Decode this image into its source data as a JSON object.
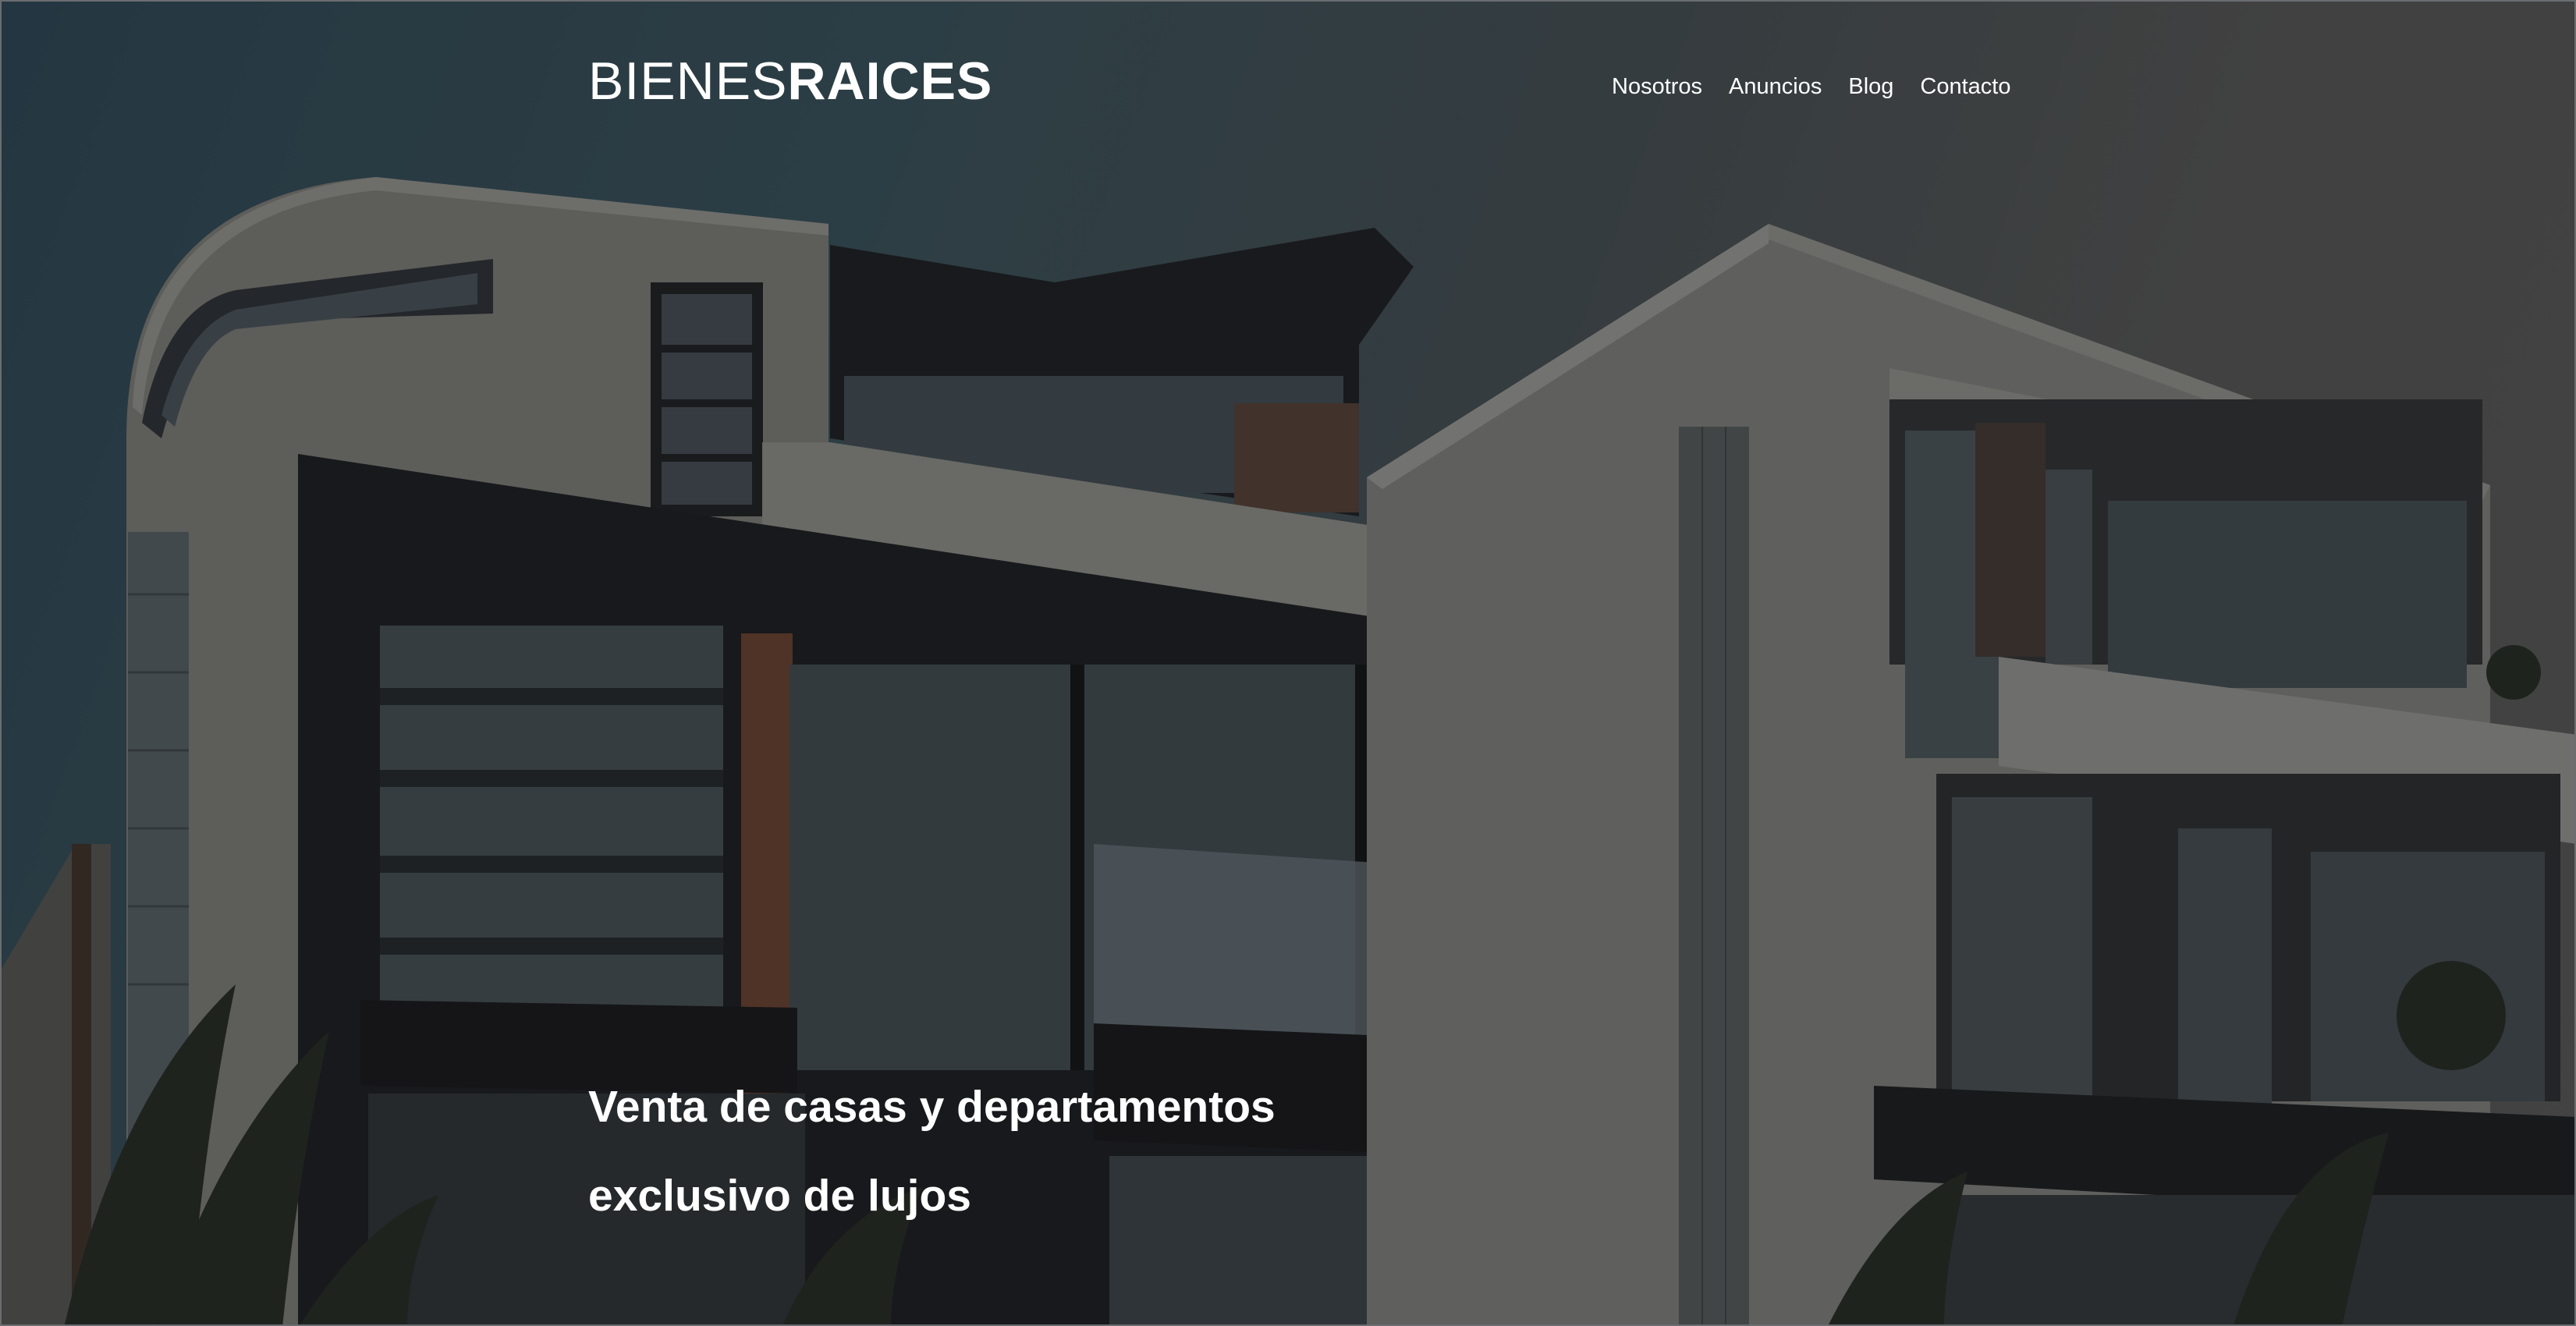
{
  "header": {
    "logo_light": "BIENES",
    "logo_bold": "RAICES"
  },
  "nav": {
    "items": [
      {
        "label": "Nosotros"
      },
      {
        "label": "Anuncios"
      },
      {
        "label": "Blog"
      },
      {
        "label": "Contacto"
      }
    ]
  },
  "hero": {
    "heading_line1": "Venta de casas y departamentos",
    "heading_line2": "exclusivo de lujos",
    "background": "modern-house-photo"
  },
  "colors": {
    "text": "#ffffff",
    "sky": "#2f434d",
    "wall": "#6f6f6c",
    "dark_panel": "#1e1f22"
  }
}
